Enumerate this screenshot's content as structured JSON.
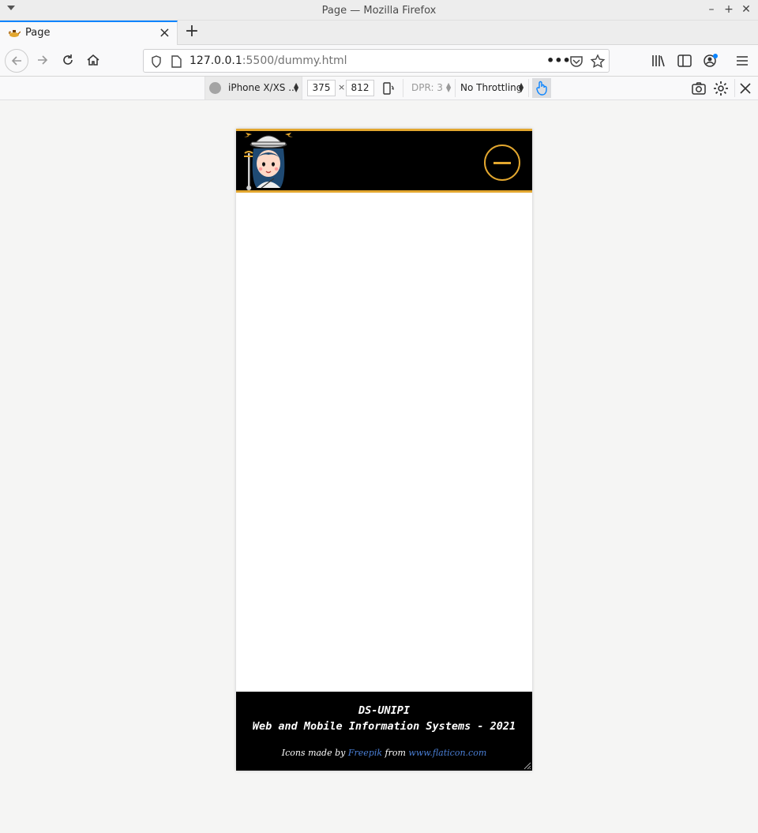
{
  "window": {
    "title": "Page — Mozilla Firefox",
    "controls": [
      "minimize-icon",
      "maximize-icon",
      "close-icon"
    ]
  },
  "tabs": [
    {
      "label": "Page",
      "favicon": "genie-lamp-icon",
      "active": true
    }
  ],
  "navbar": {
    "url_host": "127.0.0.1",
    "url_rest": ":5500/dummy.html",
    "buttons": [
      "back-icon",
      "forward-icon",
      "reload-icon",
      "home-icon",
      "library-icon",
      "sidebar-icon",
      "account-icon",
      "menu-icon"
    ]
  },
  "rdm": {
    "device": "iPhone X/XS ...",
    "width": "375",
    "times": "×",
    "height": "812",
    "dpr": "DPR: 3",
    "throttling": "No Throttling"
  },
  "site": {
    "footer": {
      "line1": "DS-UNIPI",
      "line2": "Web and Mobile Information Systems - 2021",
      "credits_prefix": "Icons made by ",
      "credits_author": "Freepik",
      "credits_middle": " from ",
      "credits_site": "www.flaticon.com"
    },
    "colors": {
      "accent": "#e3a72f",
      "header_bg": "#000000",
      "link": "#4a7fd6"
    }
  }
}
